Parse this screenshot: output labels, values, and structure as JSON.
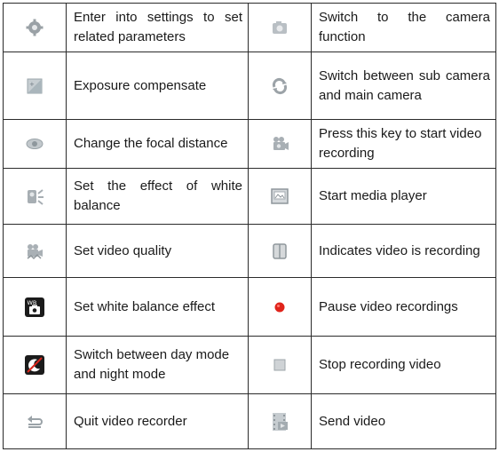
{
  "rows": [
    {
      "left": {
        "icon": "settings-gear-icon",
        "text": "Enter into settings to set related parameters",
        "justify": true
      },
      "right": {
        "icon": "camera-icon",
        "text": "Switch to the camera function",
        "justify": true
      }
    },
    {
      "left": {
        "icon": "exposure-compensate-icon",
        "text": "Exposure compensate",
        "justify": false
      },
      "right": {
        "icon": "switch-camera-icon",
        "text": "Switch between sub camera and main camera",
        "justify": true
      }
    },
    {
      "left": {
        "icon": "focus-eye-icon",
        "text": "Change the focal distance",
        "justify": false
      },
      "right": {
        "icon": "video-camera-icon",
        "text": "Press this key to start video recording",
        "justify": false
      }
    },
    {
      "left": {
        "icon": "white-balance-effect-icon",
        "text": "Set the effect of white balance",
        "justify": true
      },
      "right": {
        "icon": "media-player-icon",
        "text": "Start media player",
        "justify": false
      }
    },
    {
      "left": {
        "icon": "video-quality-icon",
        "text": "Set video quality",
        "justify": false
      },
      "right": {
        "icon": "recording-indicator-icon",
        "text": "Indicates video is recording",
        "justify": false
      }
    },
    {
      "left": {
        "icon": "wb-camera-icon",
        "text": "Set white balance effect",
        "justify": false
      },
      "right": {
        "icon": "red-dot-icon",
        "text": "Pause video recordings",
        "justify": false
      }
    },
    {
      "left": {
        "icon": "night-mode-icon",
        "text": "Switch between day mode and night mode",
        "justify": false
      },
      "right": {
        "icon": "stop-square-icon",
        "text": "Stop recording video",
        "justify": false
      }
    },
    {
      "left": {
        "icon": "back-arrow-icon",
        "text": "Quit video recorder",
        "justify": false
      },
      "right": {
        "icon": "send-video-icon",
        "text": "Send video",
        "justify": false
      }
    }
  ],
  "icon_label": "WB"
}
